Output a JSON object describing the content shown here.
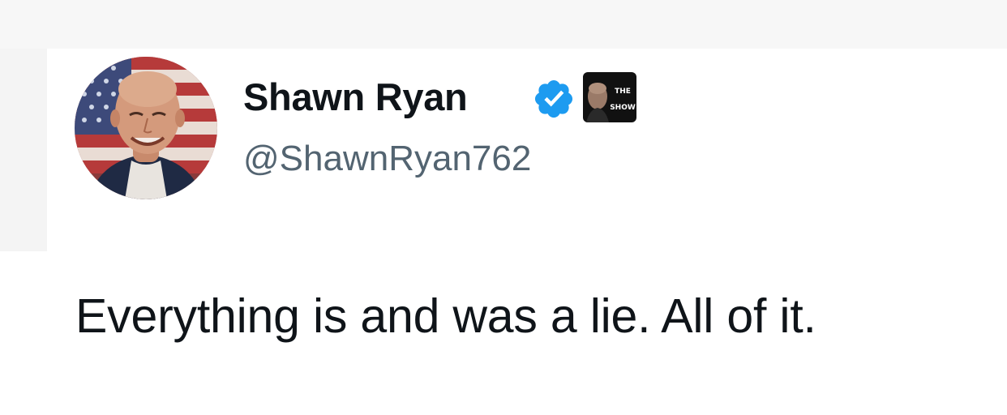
{
  "author": {
    "display_name": "Shawn Ryan",
    "handle": "@ShawnRyan762",
    "verified_icon": "verified-badge-icon",
    "avatar_icon": "profile-photo",
    "affiliate_badge": {
      "icon": "shawn-ryan-show-logo",
      "text": "THE\nSHOW"
    }
  },
  "tweet": {
    "text": "Everything is and was a lie. All of it."
  },
  "colors": {
    "text_primary": "#0f1419",
    "text_secondary": "#536471",
    "verified_blue": "#1d9bf0"
  }
}
